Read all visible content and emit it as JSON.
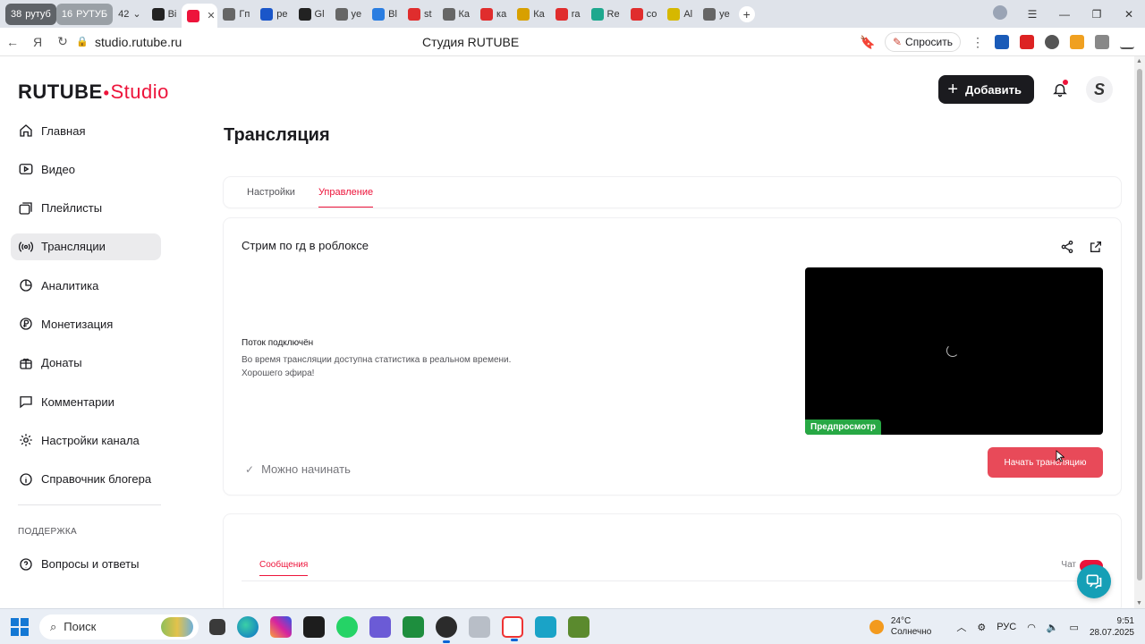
{
  "browser": {
    "tabs": [
      {
        "type": "group",
        "label": "38",
        "extra": "рутуб"
      },
      {
        "type": "group2",
        "label": "16",
        "extra": "РУТУБ"
      },
      {
        "type": "count",
        "label": "42"
      },
      {
        "type": "tab",
        "label": "Ві",
        "color": "#222"
      },
      {
        "type": "active",
        "label": "",
        "color": "#ed143b"
      },
      {
        "type": "tab",
        "label": "Гп",
        "color": "#666"
      },
      {
        "type": "tab",
        "label": "ре",
        "color": "#1a56c9"
      },
      {
        "type": "tab",
        "label": "Gl",
        "color": "#222"
      },
      {
        "type": "tab",
        "label": "ye",
        "color": "#666"
      },
      {
        "type": "tab",
        "label": "Bl",
        "color": "#2a7de1"
      },
      {
        "type": "tab",
        "label": "st",
        "color": "#e02d2d"
      },
      {
        "type": "tab",
        "label": "Ка",
        "color": "#666"
      },
      {
        "type": "tab",
        "label": "ка",
        "color": "#e02d2d"
      },
      {
        "type": "tab",
        "label": "Ка",
        "color": "#d8a000"
      },
      {
        "type": "tab",
        "label": "ra",
        "color": "#e02d2d"
      },
      {
        "type": "tab",
        "label": "Re",
        "color": "#1ea88e"
      },
      {
        "type": "tab",
        "label": "со",
        "color": "#e02d2d"
      },
      {
        "type": "tab",
        "label": "Al",
        "color": "#d6b800"
      },
      {
        "type": "tab",
        "label": "ye",
        "color": "#666"
      }
    ],
    "url": "studio.rutube.ru",
    "page_title": "Студия RUTUBE",
    "ask_label": "Спросить"
  },
  "header": {
    "logo_text": "RUTUBE",
    "logo_studio": "Studio",
    "add_label": "Добавить"
  },
  "sidebar": {
    "items": [
      {
        "label": "Главная",
        "icon": "home-icon",
        "active": false
      },
      {
        "label": "Видео",
        "icon": "video-icon",
        "active": false
      },
      {
        "label": "Плейлисты",
        "icon": "playlist-icon",
        "active": false
      },
      {
        "label": "Трансляции",
        "icon": "broadcast-icon",
        "active": true
      },
      {
        "label": "Аналитика",
        "icon": "analytics-icon",
        "active": false
      },
      {
        "label": "Монетизация",
        "icon": "money-icon",
        "active": false
      },
      {
        "label": "Донаты",
        "icon": "donate-icon",
        "active": false
      },
      {
        "label": "Комментарии",
        "icon": "comments-icon",
        "active": false
      },
      {
        "label": "Настройки канала",
        "icon": "gear-icon",
        "active": false
      },
      {
        "label": "Справочник блогера",
        "icon": "info-icon",
        "active": false
      }
    ],
    "support_section": "ПОДДЕРЖКА",
    "support_items": [
      {
        "label": "Вопросы и ответы",
        "icon": "question-icon"
      }
    ]
  },
  "main": {
    "title": "Трансляция",
    "tabs": [
      {
        "label": "Настройки",
        "active": false
      },
      {
        "label": "Управление",
        "active": true
      }
    ],
    "stream": {
      "name": "Стрим по гд в роблоксе",
      "status_title": "Поток подключён",
      "status_text": "Во время трансляции доступна статистика в реальном времени. Хорошего эфира!",
      "preview_label": "Предпросмотр",
      "ready_label": "Можно начинать",
      "start_button": "Начать трансляцию"
    },
    "chat": {
      "tab_label": "Сообщения",
      "toggle_label": "Чат"
    }
  },
  "taskbar": {
    "search_placeholder": "Поиск",
    "weather_temp": "24°C",
    "weather_desc": "Солнечно",
    "lang": "РУС",
    "time": "9:51",
    "date": "28.07.2025"
  },
  "colors": {
    "accent": "#ed143b",
    "start_button": "#e84a59",
    "preview_badge": "#27a844",
    "help_fab": "#169fb6"
  }
}
